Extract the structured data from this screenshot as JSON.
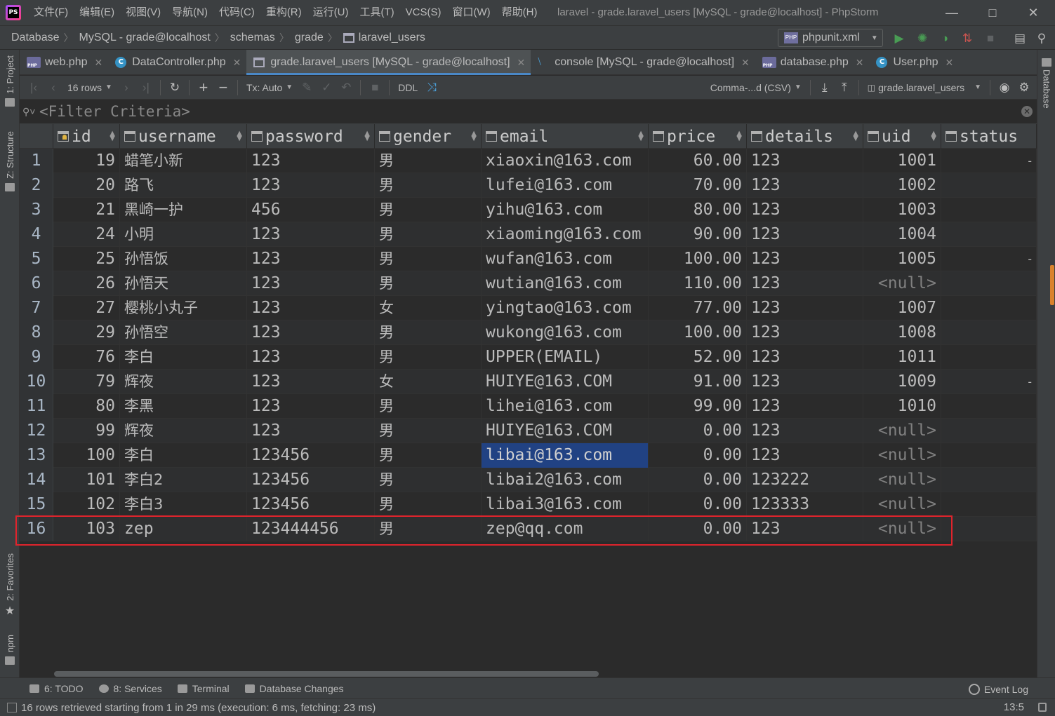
{
  "app": {
    "logo_text": "PS",
    "menus": [
      "文件(F)",
      "编辑(E)",
      "视图(V)",
      "导航(N)",
      "代码(C)",
      "重构(R)",
      "运行(U)",
      "工具(T)",
      "VCS(S)",
      "窗口(W)",
      "帮助(H)"
    ],
    "window_title": "laravel - grade.laravel_users [MySQL - grade@localhost] - PhpStorm"
  },
  "breadcrumb": [
    "Database",
    "MySQL - grade@localhost",
    "schemas",
    "grade",
    "laravel_users"
  ],
  "run_config": "phpunit.xml",
  "tabs": [
    {
      "label": "web.php",
      "icon": "php-file-icon",
      "active": false
    },
    {
      "label": "DataController.php",
      "icon": "php-class-icon",
      "active": false
    },
    {
      "label": "grade.laravel_users [MySQL - grade@localhost]",
      "icon": "table-icon",
      "active": true
    },
    {
      "label": "console [MySQL - grade@localhost]",
      "icon": "console-icon",
      "active": false
    },
    {
      "label": "database.php",
      "icon": "php-file-icon",
      "active": false
    },
    {
      "label": "User.php",
      "icon": "php-class-icon",
      "active": false
    }
  ],
  "toolbar": {
    "rows_label": "16 rows",
    "tx_label": "Tx: Auto",
    "ddl_label": "DDL",
    "export_format": "Comma-...d (CSV)",
    "table_target": "grade.laravel_users"
  },
  "filter": {
    "placeholder": "<Filter Criteria>"
  },
  "columns": [
    "id",
    "username",
    "password",
    "gender",
    "email",
    "price",
    "details",
    "uid",
    "status"
  ],
  "rows": [
    {
      "n": "1",
      "id": "19",
      "username": "蜡笔小新",
      "password": "123",
      "gender": "男",
      "email": "xiaoxin@163.com",
      "price": "60.00",
      "details": "123",
      "uid": "1001",
      "status": "-"
    },
    {
      "n": "2",
      "id": "20",
      "username": "路飞",
      "password": "123",
      "gender": "男",
      "email": "lufei@163.com",
      "price": "70.00",
      "details": "123",
      "uid": "1002",
      "status": ""
    },
    {
      "n": "3",
      "id": "21",
      "username": "黑崎一护",
      "password": "456",
      "gender": "男",
      "email": "yihu@163.com",
      "price": "80.00",
      "details": "123",
      "uid": "1003",
      "status": ""
    },
    {
      "n": "4",
      "id": "24",
      "username": "小明",
      "password": "123",
      "gender": "男",
      "email": "xiaoming@163.com",
      "price": "90.00",
      "details": "123",
      "uid": "1004",
      "status": ""
    },
    {
      "n": "5",
      "id": "25",
      "username": "孙悟饭",
      "password": "123",
      "gender": "男",
      "email": "wufan@163.com",
      "price": "100.00",
      "details": "123",
      "uid": "1005",
      "status": "-"
    },
    {
      "n": "6",
      "id": "26",
      "username": "孙悟天",
      "password": "123",
      "gender": "男",
      "email": "wutian@163.com",
      "price": "110.00",
      "details": "123",
      "uid": "<null>",
      "status": ""
    },
    {
      "n": "7",
      "id": "27",
      "username": "樱桃小丸子",
      "password": "123",
      "gender": "女",
      "email": "yingtao@163.com",
      "price": "77.00",
      "details": "123",
      "uid": "1007",
      "status": ""
    },
    {
      "n": "8",
      "id": "29",
      "username": "孙悟空",
      "password": "123",
      "gender": "男",
      "email": "wukong@163.com",
      "price": "100.00",
      "details": "123",
      "uid": "1008",
      "status": ""
    },
    {
      "n": "9",
      "id": "76",
      "username": "李白",
      "password": "123",
      "gender": "男",
      "email": "UPPER(EMAIL)",
      "price": "52.00",
      "details": "123",
      "uid": "1011",
      "status": ""
    },
    {
      "n": "10",
      "id": "79",
      "username": "辉夜",
      "password": "123",
      "gender": "女",
      "email": "HUIYE@163.COM",
      "price": "91.00",
      "details": "123",
      "uid": "1009",
      "status": "-"
    },
    {
      "n": "11",
      "id": "80",
      "username": "李黑",
      "password": "123",
      "gender": "男",
      "email": "lihei@163.com",
      "price": "99.00",
      "details": "123",
      "uid": "1010",
      "status": ""
    },
    {
      "n": "12",
      "id": "99",
      "username": "辉夜",
      "password": "123",
      "gender": "男",
      "email": "HUIYE@163.COM",
      "price": "0.00",
      "details": "123",
      "uid": "<null>",
      "status": ""
    },
    {
      "n": "13",
      "id": "100",
      "username": "李白",
      "password": "123456",
      "gender": "男",
      "email": "libai@163.com",
      "price": "0.00",
      "details": "123",
      "uid": "<null>",
      "status": "",
      "selected": "email"
    },
    {
      "n": "14",
      "id": "101",
      "username": "李白2",
      "password": "123456",
      "gender": "男",
      "email": "libai2@163.com",
      "price": "0.00",
      "details": "123222",
      "uid": "<null>",
      "status": ""
    },
    {
      "n": "15",
      "id": "102",
      "username": "李白3",
      "password": "123456",
      "gender": "男",
      "email": "libai3@163.com",
      "price": "0.00",
      "details": "123333",
      "uid": "<null>",
      "status": ""
    },
    {
      "n": "16",
      "id": "103",
      "username": "zep",
      "password": "123444456",
      "gender": "男",
      "email": "zep@qq.com",
      "price": "0.00",
      "details": "123",
      "uid": "<null>",
      "status": ""
    }
  ],
  "left_tool_tabs": [
    "1: Project",
    "Z: Structure",
    "2: Favorites",
    "npm"
  ],
  "right_tool_tabs": [
    "Database"
  ],
  "bottom_tools": [
    "6: TODO",
    "8: Services",
    "Terminal",
    "Database Changes"
  ],
  "event_log": "Event Log",
  "status": {
    "message": "16 rows retrieved starting from 1 in 29 ms (execution: 6 ms, fetching: 23 ms)",
    "caret": "13:5"
  },
  "colors": {
    "background": "#2b2b2b",
    "panel": "#3c3f41",
    "selection": "#214283",
    "highlight_box": "#e0242c",
    "active_tab_underline": "#4a88c7",
    "run_green": "#499c54"
  }
}
